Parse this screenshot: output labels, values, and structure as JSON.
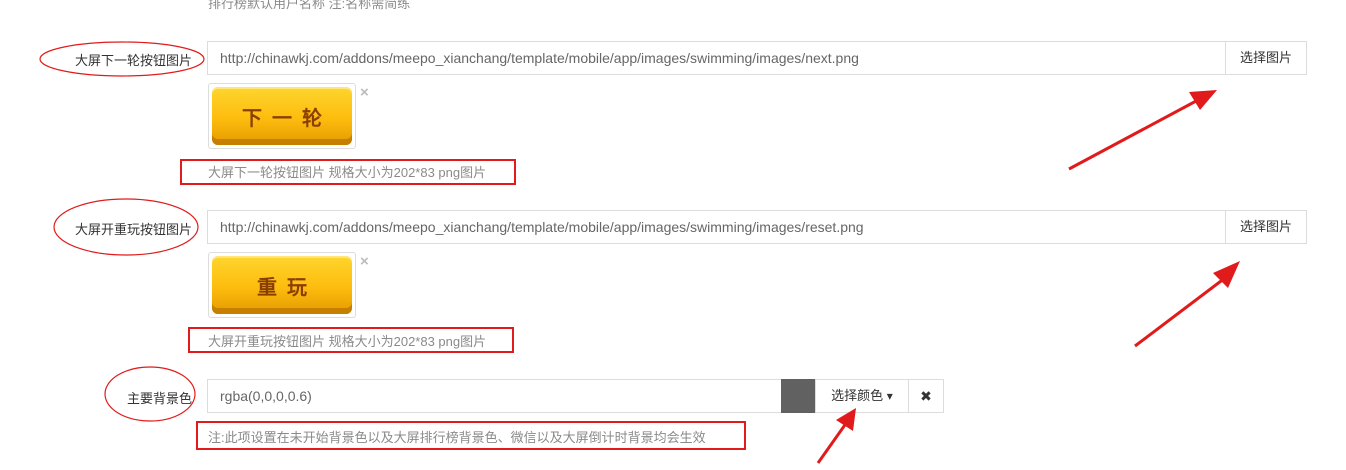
{
  "top_hint": "排行榜默认用户名称 注:名称需简练",
  "next_round": {
    "label": "大屏下一轮按钮图片",
    "url": "http://chinawkj.com/addons/meepo_xianchang/template/mobile/app/images/swimming/images/next.png",
    "select_button": "选择图片",
    "preview_text": "下一轮",
    "help": "大屏下一轮按钮图片 规格大小为202*83 png图片"
  },
  "replay": {
    "label": "大屏开重玩按钮图片",
    "url": "http://chinawkj.com/addons/meepo_xianchang/template/mobile/app/images/swimming/images/reset.png",
    "select_button": "选择图片",
    "preview_text": "重玩",
    "help": "大屏开重玩按钮图片 规格大小为202*83 png图片"
  },
  "main_bg_color": {
    "label": "主要背景色",
    "value": "rgba(0,0,0,0.6)",
    "swatch_color": "#616161",
    "select_button": "选择颜色",
    "clear_icon": "✖",
    "help": "注:此项设置在未开始背景色以及大屏排行榜背景色、微信以及大屏倒计时背景均会生效"
  },
  "remove_icon": "×",
  "caret_icon": "▾",
  "annotation_color": "#e11b1b"
}
